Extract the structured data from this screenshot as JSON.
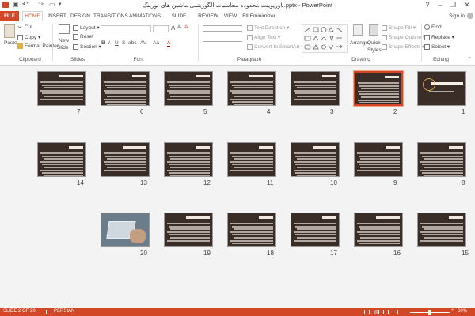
{
  "title_bar": {
    "title": "پاورپوینت محدوده محاسبات الگوریتمی ماشین های تورینگ.pptx - PowerPoint",
    "help": "?",
    "minimize": "–",
    "restore": "❐",
    "close": "✕"
  },
  "tabs": [
    {
      "label": "FILE"
    },
    {
      "label": "HOME"
    },
    {
      "label": "INSERT"
    },
    {
      "label": "DESIGN"
    },
    {
      "label": "TRANSITIONS"
    },
    {
      "label": "ANIMATIONS"
    },
    {
      "label": "SLIDE SHOW"
    },
    {
      "label": "REVIEW"
    },
    {
      "label": "VIEW"
    },
    {
      "label": "FILEminimizer"
    }
  ],
  "sign_in": "Sign in",
  "ribbon": {
    "clipboard": {
      "paste": "Paste",
      "cut": "Cut",
      "copy": "Copy",
      "format_painter": "Format Painter",
      "label": "Clipboard"
    },
    "slides": {
      "new_slide": "New",
      "new_slide2": "Slide",
      "layout": "Layout",
      "reset": "Reset",
      "section": "Section",
      "label": "Slides"
    },
    "font": {
      "label": "Font",
      "bold": "B",
      "italic": "I",
      "underline": "U",
      "strike": "S",
      "shadow": "abc",
      "spacing": "AV",
      "case": "Aa",
      "size_up": "A",
      "size_down": "A",
      "clear": "A",
      "color": "A"
    },
    "paragraph": {
      "text_direction": "Text Direction",
      "align_text": "Align Text",
      "convert": "Convert to SmartArt",
      "label": "Paragraph"
    },
    "drawing": {
      "arrange": "Arrange",
      "quick_styles": "Quick",
      "quick_styles2": "Styles",
      "shape_fill": "Shape Fill",
      "shape_outline": "Shape Outline",
      "shape_effects": "Shape Effects",
      "label": "Drawing"
    },
    "editing": {
      "find": "Find",
      "replace": "Replace",
      "select": "Select",
      "label": "Editing"
    }
  },
  "slides": [
    {
      "num": "1"
    },
    {
      "num": "2",
      "selected": true
    },
    {
      "num": "3"
    },
    {
      "num": "4"
    },
    {
      "num": "5"
    },
    {
      "num": "6"
    },
    {
      "num": "7"
    },
    {
      "num": "8"
    },
    {
      "num": "9"
    },
    {
      "num": "10"
    },
    {
      "num": "11"
    },
    {
      "num": "12"
    },
    {
      "num": "13"
    },
    {
      "num": "14"
    },
    {
      "num": "15"
    },
    {
      "num": "16"
    },
    {
      "num": "17"
    },
    {
      "num": "18"
    },
    {
      "num": "19"
    },
    {
      "num": "20"
    }
  ],
  "status": {
    "slide_info": "SLIDE 2 OF 20",
    "language": "PERSIAN",
    "zoom_minus": "–",
    "zoom_plus": "+",
    "zoom": "60%"
  },
  "colors": {
    "accent": "#d24726",
    "slide_bg": "#3a2c26"
  }
}
